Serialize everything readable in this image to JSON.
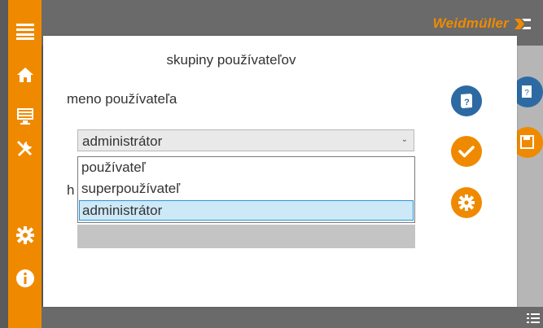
{
  "brand": {
    "name": "Weidmüller",
    "color": "#ef8a00"
  },
  "colors": {
    "accent": "#ef8a00",
    "button_blue": "#2d6aa3",
    "selected_option": "#cde8f7"
  },
  "sidebar": {
    "icons": [
      "menu-icon",
      "home-icon",
      "monitor-icon",
      "tools-icon",
      "gear-icon",
      "info-icon"
    ]
  },
  "dialog": {
    "title": "skupiny používateľov",
    "username_label": "meno používateľa",
    "password_label_partial": "h",
    "user_group_select": {
      "value": "administrátor",
      "options": [
        {
          "label": "používateľ",
          "selected": false
        },
        {
          "label": "superpoužívateľ",
          "selected": false
        },
        {
          "label": "administrátor",
          "selected": true
        }
      ]
    },
    "buttons": [
      "help-button",
      "confirm-button",
      "settings-button"
    ]
  }
}
